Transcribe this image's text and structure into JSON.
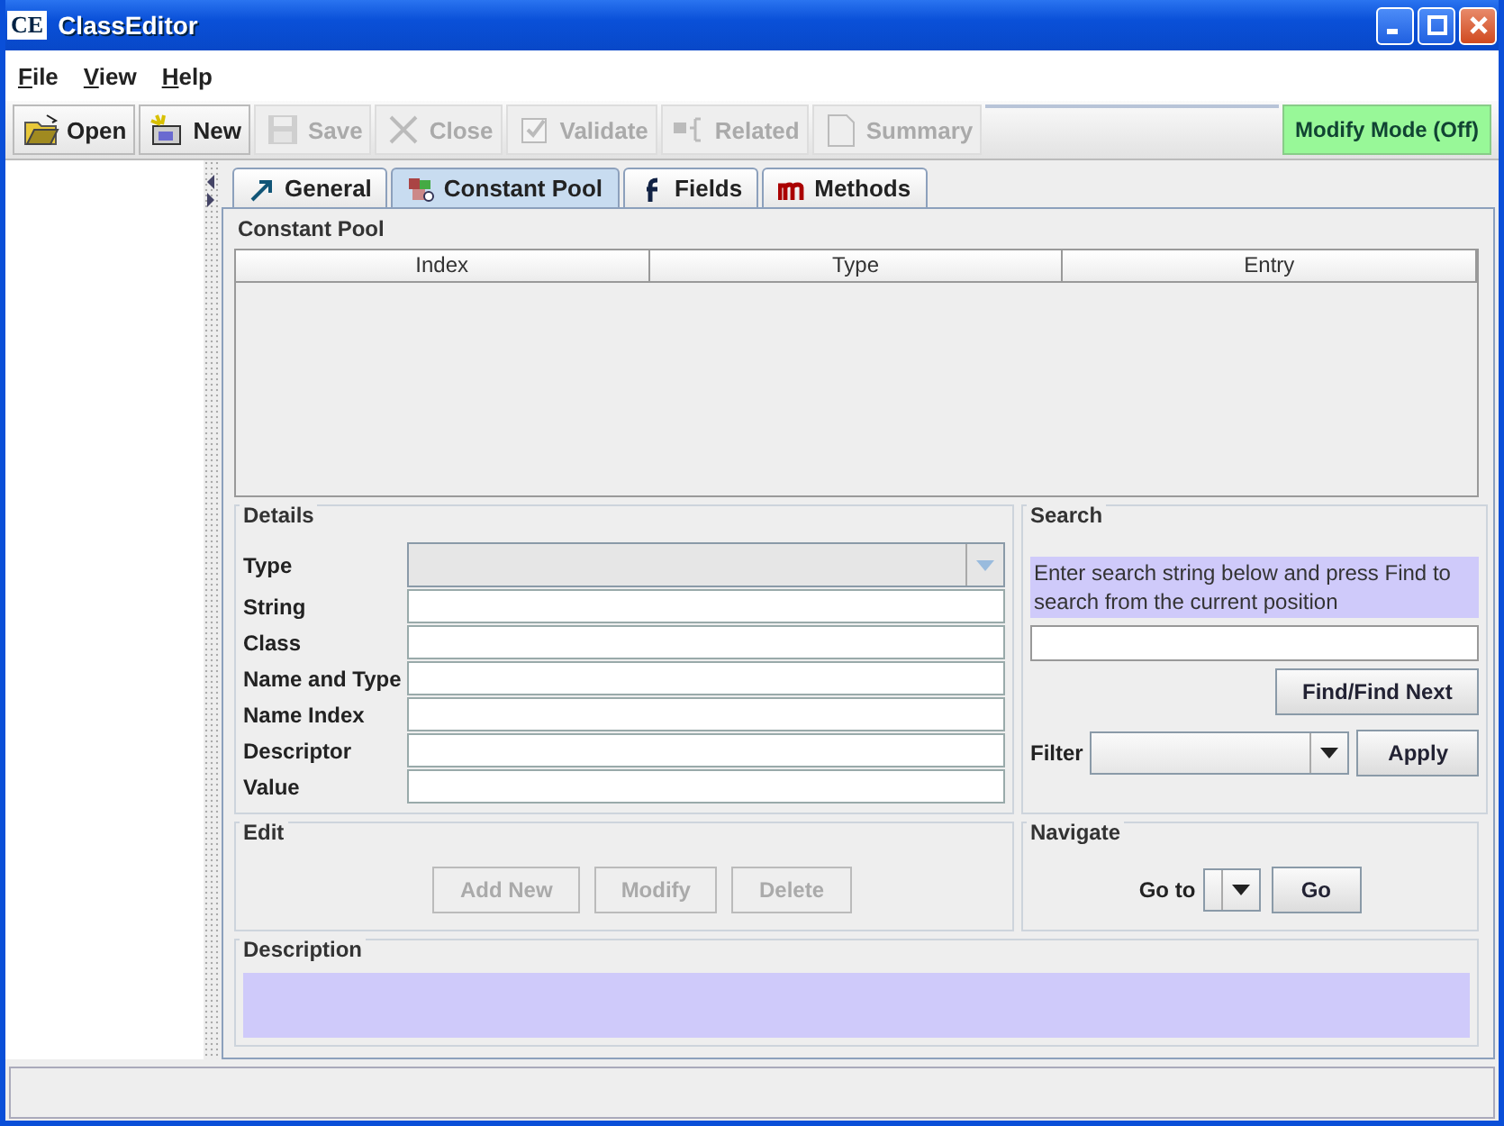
{
  "window": {
    "title": "ClassEditor",
    "logo": "CE"
  },
  "menu": [
    {
      "label": "File"
    },
    {
      "label": "View"
    },
    {
      "label": "Help"
    }
  ],
  "toolbar": [
    {
      "label": "Open",
      "disabled": false
    },
    {
      "label": "New",
      "disabled": false
    },
    {
      "label": "Save",
      "disabled": true
    },
    {
      "label": "Close",
      "disabled": true
    },
    {
      "label": "Validate",
      "disabled": true
    },
    {
      "label": "Related",
      "disabled": true
    },
    {
      "label": "Summary",
      "disabled": true
    }
  ],
  "mode_button": {
    "label": "Modify Mode (Off)",
    "on": false
  },
  "tabs": [
    {
      "label": "General",
      "selected": false
    },
    {
      "label": "Constant Pool",
      "selected": true
    },
    {
      "label": "Fields",
      "selected": false
    },
    {
      "label": "Methods",
      "selected": false
    }
  ],
  "constant_pool": {
    "title": "Constant Pool",
    "columns": [
      "Index",
      "Type",
      "Entry"
    ]
  },
  "details": {
    "title": "Details",
    "fields": [
      {
        "label": "Type",
        "kind": "combo",
        "disabled": true
      },
      {
        "label": "String",
        "kind": "text",
        "disabled": false
      },
      {
        "label": "Class",
        "kind": "text",
        "disabled": false
      },
      {
        "label": "Name and Type",
        "kind": "text",
        "disabled": false
      },
      {
        "label": "Name Index",
        "kind": "text",
        "disabled": false
      },
      {
        "label": "Descriptor",
        "kind": "text",
        "disabled": false
      },
      {
        "label": "Value",
        "kind": "text",
        "disabled": false
      }
    ]
  },
  "search": {
    "title": "Search",
    "hint": "Enter search string below and press Find to search from the current position",
    "find_button": "Find/Find Next",
    "filter_label": "Filter",
    "apply_button": "Apply"
  },
  "edit": {
    "title": "Edit",
    "buttons": [
      {
        "label": "Add New",
        "disabled": true
      },
      {
        "label": "Modify",
        "disabled": true
      },
      {
        "label": "Delete",
        "disabled": true
      }
    ]
  },
  "navigate": {
    "title": "Navigate",
    "label": "Go to",
    "go_button": "Go"
  },
  "description": {
    "title": "Description"
  }
}
